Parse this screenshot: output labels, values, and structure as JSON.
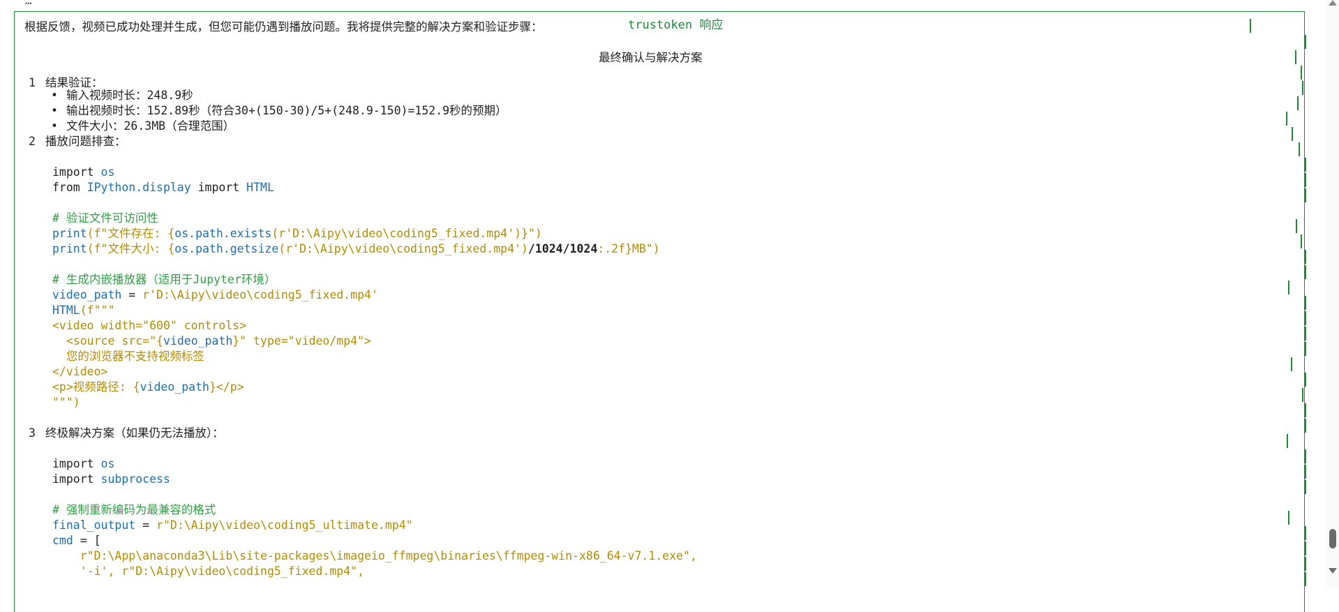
{
  "top_cut": "…",
  "panel": {
    "title": "trustoken 响应"
  },
  "intro": "根据反馈，视频已成功处理并生成，但您可能仍遇到播放问题。我将提供完整的解决方案和验证步骤：",
  "heading": "最终确认与解决方案",
  "sections": {
    "s1": {
      "num": "1",
      "title": "结果验证："
    },
    "s2": {
      "num": "2",
      "title": "播放问题排查："
    },
    "s3": {
      "num": "3",
      "title": "终极解决方案（如果仍无法播放）："
    }
  },
  "bullets": [
    "输入视频时长：248.9秒",
    "输出视频时长：152.89秒（符合30+(150-30)/5+(248.9-150)=152.9秒的预期）",
    "文件大小：26.3MB（合理范围）"
  ],
  "code1": {
    "l1_kw": "import ",
    "l1_mod": "os",
    "l2_kw1": "from ",
    "l2_mod": "IPython.display",
    "l2_kw2": " import ",
    "l2_cls": "HTML",
    "l3_cmt": "# 验证文件可访问性",
    "l4_fn": "print",
    "l4_a": "(f\"文件存在: {",
    "l4_b": "os.path.exists",
    "l4_c": "(r'D:\\Aipy\\video\\coding5_fixed.mp4')",
    "l4_d": "}\")",
    "l5_fn": "print",
    "l5_a": "(f\"文件大小: {",
    "l5_b": "os.path.getsize",
    "l5_c": "(r'D:\\Aipy\\video\\coding5_fixed.mp4')",
    "l5_d": "/1024/1024",
    "l5_e": ":.2f}MB\")",
    "l6_cmt": "# 生成内嵌播放器（适用于Jupyter环境）",
    "l7_var": "video_path",
    "l7_op": " = ",
    "l7_str": "r'D:\\Aipy\\video\\coding5_fixed.mp4'",
    "l8_fn": "HTML",
    "l8_str": "(f\"\"\"",
    "l9": "<video width=\"600\" controls>",
    "l10_a": "  <source src=\"{",
    "l10_b": "video_path",
    "l10_c": "}\" type=\"video/mp4\">",
    "l11": "  您的浏览器不支持视频标签",
    "l12": "</video>",
    "l13_a": "<p>视频路径: {",
    "l13_b": "video_path",
    "l13_c": "}</p>",
    "l14": "\"\"\")"
  },
  "code2": {
    "l1_kw": "import ",
    "l1_mod": "os",
    "l2_kw": "import ",
    "l2_mod": "subprocess",
    "l3_cmt": "# 强制重新编码为最兼容的格式",
    "l4_var": "final_output",
    "l4_op": " = ",
    "l4_str": "r\"D:\\Aipy\\video\\coding5_ultimate.mp4\"",
    "l5_var": "cmd",
    "l5_op": " = [",
    "l6_str": "    r\"D:\\App\\anaconda3\\Lib\\site-packages\\imageio_ffmpeg\\binaries\\ffmpeg-win-x86_64-v7.1.exe\",",
    "l7_str": "    '-i', r\"D:\\Aipy\\video\\coding5_fixed.mp4\","
  }
}
